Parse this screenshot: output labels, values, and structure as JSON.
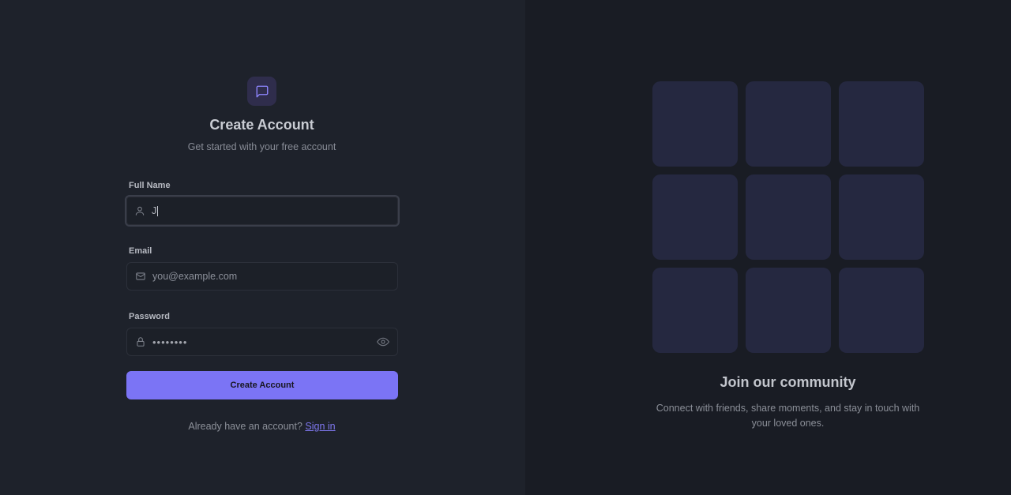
{
  "colors": {
    "accent": "#7b74f5",
    "left_bg": "#1e222b",
    "right_bg": "#191c24",
    "tile": "#252840"
  },
  "form": {
    "logo_icon": "message-square-icon",
    "title": "Create Account",
    "subtitle": "Get started with your free account",
    "full_name": {
      "label": "Full Name",
      "value": "J",
      "icon": "user-icon"
    },
    "email": {
      "label": "Email",
      "placeholder": "you@example.com",
      "icon": "mail-icon"
    },
    "password": {
      "label": "Password",
      "masked_value": "••••••••",
      "icon": "lock-icon",
      "toggle_icon": "eye-icon"
    },
    "submit_label": "Create Account",
    "signin_prompt": "Already have an account?",
    "signin_link": "Sign in"
  },
  "community": {
    "tile_count": 9,
    "title": "Join our community",
    "description": "Connect with friends, share moments, and stay in touch with your loved ones."
  }
}
